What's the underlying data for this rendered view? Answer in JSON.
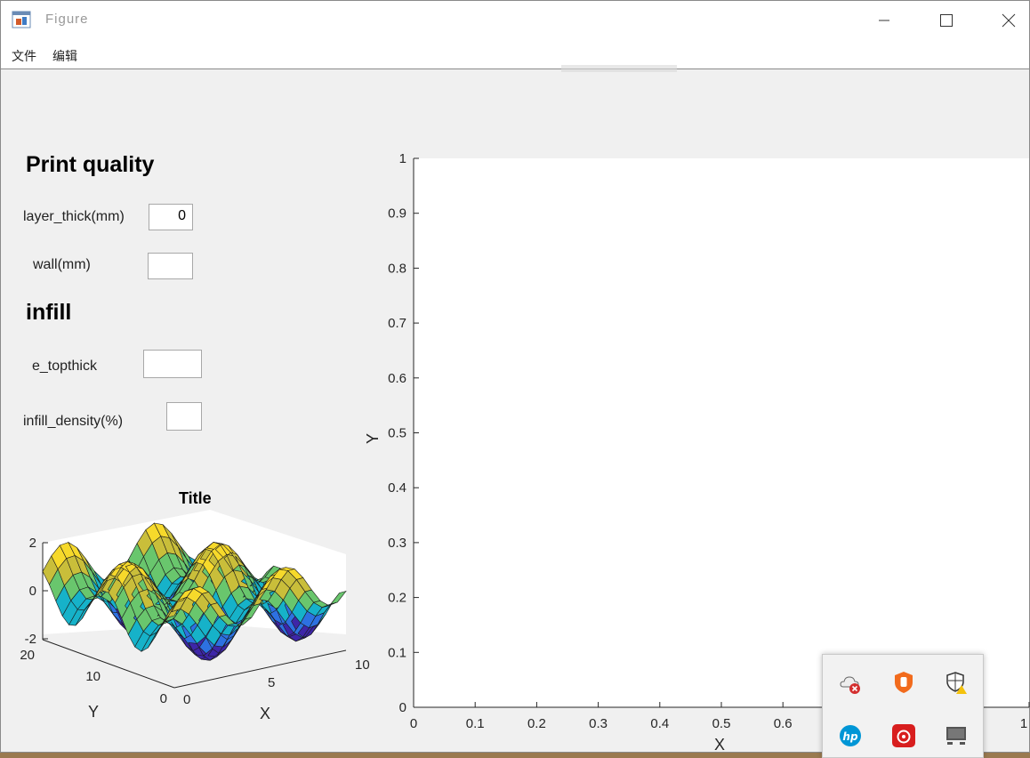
{
  "window": {
    "title": "Figure"
  },
  "menu": {
    "items": [
      "文件",
      "编辑"
    ]
  },
  "controls": {
    "heading_print_quality": "Print quality",
    "layer_thick_label": "layer_thick(mm)",
    "layer_thick_value": "0",
    "wall_label": "wall(mm)",
    "wall_value": "",
    "heading_infill": "infill",
    "topthick_label": "e_topthick",
    "topthick_value": "",
    "infill_density_label": "infill_density(%)",
    "infill_density_value": ""
  },
  "surface_plot": {
    "title": "Title",
    "xlabel": "X",
    "ylabel": "Y",
    "z_ticks": [
      "2",
      "0",
      "-2"
    ],
    "y_ticks": [
      "20",
      "10",
      "0"
    ],
    "x_ticks": [
      "0",
      "5",
      "10"
    ],
    "colormap": [
      "#3e26a8",
      "#2d71e1",
      "#16b2c9",
      "#69c66d",
      "#c9be3a",
      "#f6d92b"
    ]
  },
  "main_plot": {
    "title": "",
    "xlabel": "X",
    "ylabel": "Y",
    "y_ticks": [
      "0",
      "0.1",
      "0.2",
      "0.3",
      "0.4",
      "0.5",
      "0.6",
      "0.7",
      "0.8",
      "0.9",
      "1"
    ],
    "x_ticks": [
      "0",
      "0.1",
      "0.2",
      "0.3",
      "0.4",
      "0.5",
      "0.6",
      "1"
    ]
  },
  "chart_data": {
    "type": "line",
    "title": "",
    "xlabel": "X",
    "ylabel": "Y",
    "xlim": [
      0,
      1
    ],
    "ylim": [
      0,
      1
    ],
    "series": []
  },
  "tray": {
    "icons": [
      "onedrive-error-icon",
      "shield-app-icon",
      "windows-security-warning-icon",
      "hp-icon",
      "netease-music-icon",
      "display-icon"
    ]
  }
}
